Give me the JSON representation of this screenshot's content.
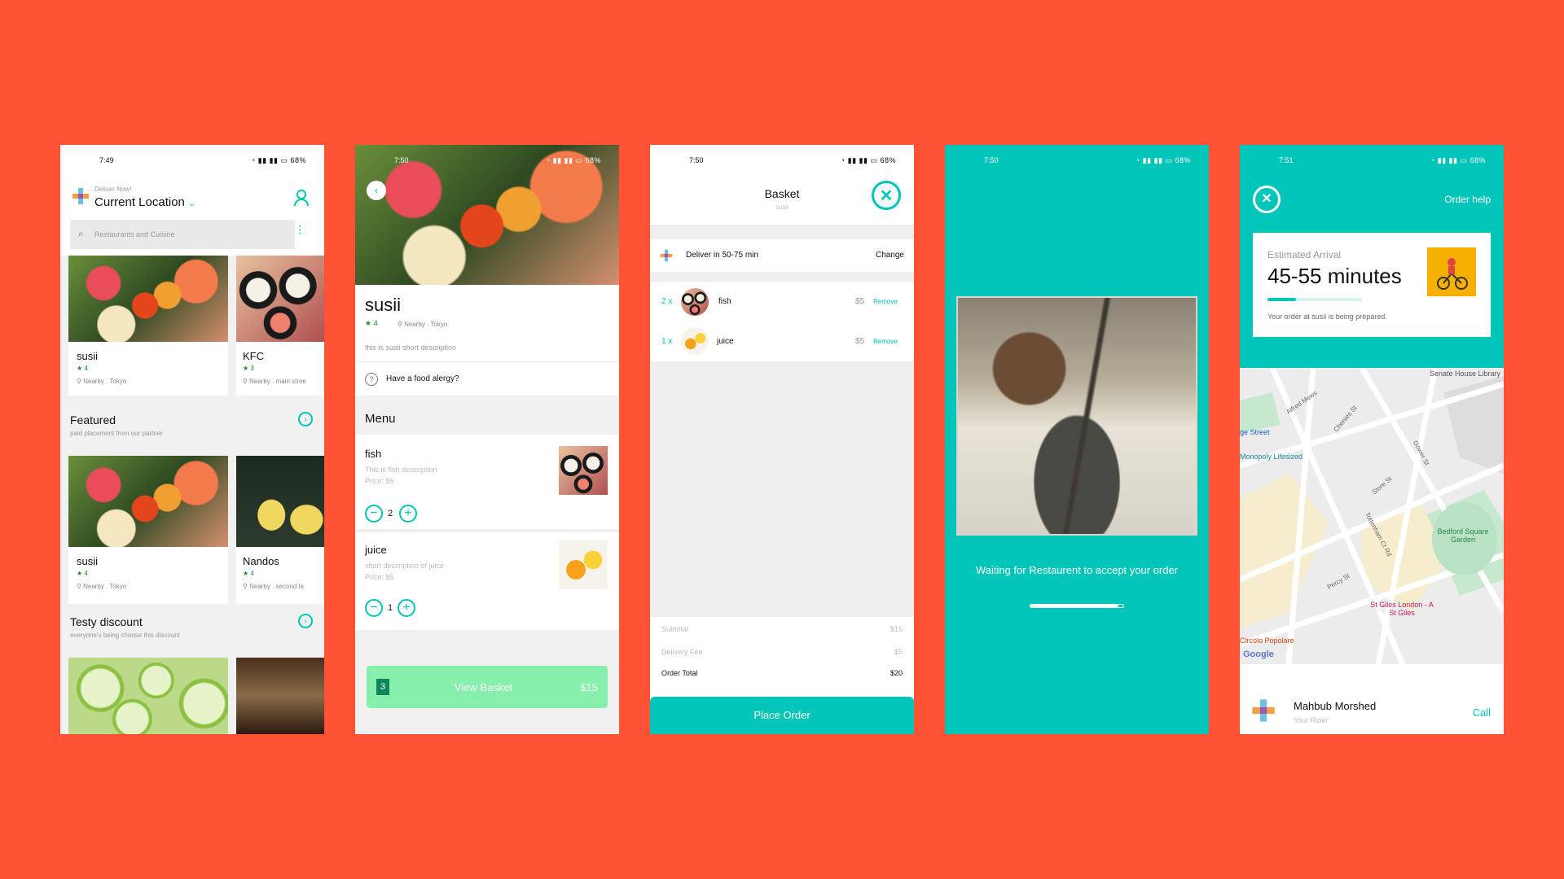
{
  "screen1": {
    "time": "7:49",
    "battery": "68%",
    "deliver_now": "Deliver Now!",
    "location": "Current Location",
    "search_placeholder": "Restaurants and Cuisine",
    "restaurants": [
      {
        "name": "susii",
        "rating": "4",
        "nearby": "Nearby . Tokyo"
      },
      {
        "name": "KFC",
        "rating": "3",
        "nearby": "Nearby . main stree"
      }
    ],
    "featured": {
      "title": "Featured",
      "subtitle": "paid placement from our partner"
    },
    "featured_restaurants": [
      {
        "name": "susii",
        "rating": "4",
        "nearby": "Nearby . Tokyo"
      },
      {
        "name": "Nandos",
        "rating": "4",
        "nearby": "Nearby . second la"
      }
    ],
    "discount": {
      "title": "Testy discount",
      "subtitle": "everyone's being choose this discount"
    }
  },
  "screen2": {
    "time": "7:50",
    "battery": "68%",
    "name": "susii",
    "rating": "4",
    "nearby": "Nearby . Tokyo",
    "description": "this is susii short description",
    "allergy": "Have a food alergy?",
    "menu_title": "Menu",
    "items": [
      {
        "name": "fish",
        "desc": "This is fish description",
        "price": "Price: $5",
        "qty": "2"
      },
      {
        "name": "juice",
        "desc": "short description of juice",
        "price": "Price: $5",
        "qty": "1"
      }
    ],
    "basket": {
      "count": "3",
      "label": "View Basket",
      "total": "$15"
    }
  },
  "screen3": {
    "time": "7:50",
    "battery": "68%",
    "title": "Basket",
    "subtitle": "susii",
    "deliver": "Deliver in 50-75 min",
    "change": "Change",
    "items": [
      {
        "qty": "2 x",
        "name": "fish",
        "price": "$5",
        "remove": "Remove"
      },
      {
        "qty": "1 x",
        "name": "juice",
        "price": "$5",
        "remove": "Remove"
      }
    ],
    "subtotal_label": "Subtotal",
    "subtotal": "$15",
    "delivery_label": "Delivery Fee",
    "delivery": "$5",
    "total_label": "Order Total",
    "total": "$20",
    "place_order": "Place Order"
  },
  "screen4": {
    "time": "7:50",
    "battery": "68%",
    "waiting": "Waiting for Restaurent to accept your order",
    "progress": 0.95
  },
  "screen5": {
    "time": "7:51",
    "battery": "68%",
    "order_help": "Order help",
    "eta_label": "Estimated Arrival",
    "eta": "45-55 minutes",
    "eta_progress": 0.3,
    "status": "Your order at susii  is being prepared.",
    "map": {
      "labels": [
        "Senate House Library",
        "ge Street",
        "Monopoly Lifesized",
        "Bedford Square Garden",
        "St Giles London - A St Giles",
        "Circolo Popolare",
        "Google",
        "Tottenham Ct Rd",
        "Store St",
        "Gower St",
        "Percy St",
        "Alfred Mews",
        "Chenies St"
      ]
    },
    "rider_name": "Mahbub Morshed",
    "rider_role": "Your Rider",
    "call": "Call"
  },
  "colors": {
    "accent": "#00C5B8",
    "background": "#FF5133",
    "basket_button": "#86EFAC",
    "rating": "#1b8a2a"
  }
}
